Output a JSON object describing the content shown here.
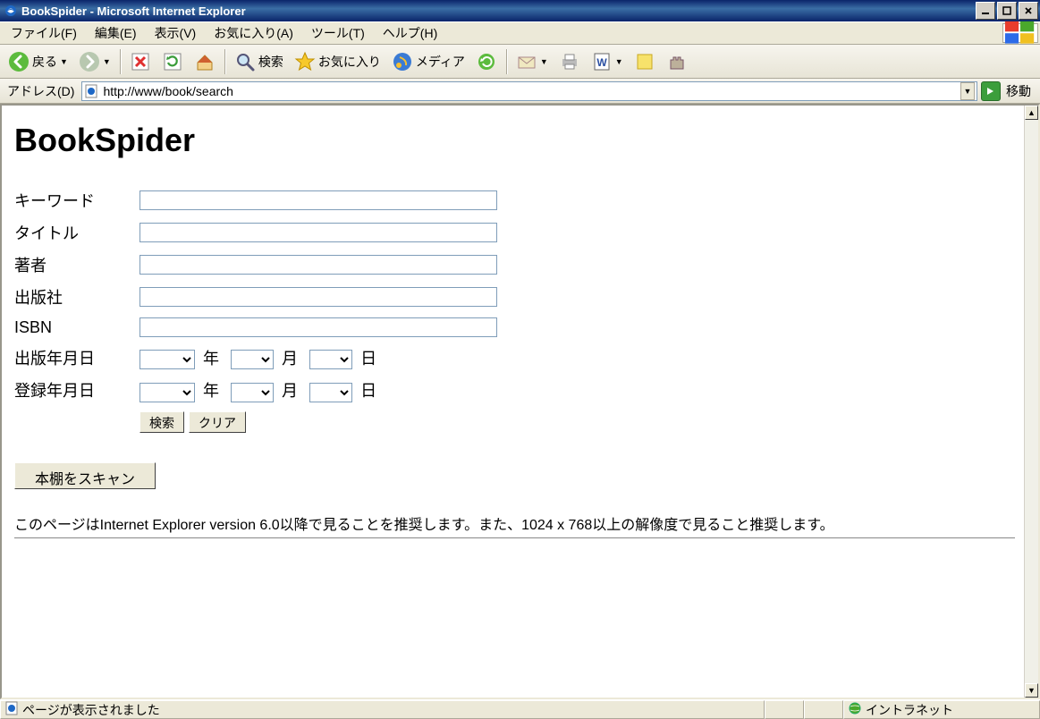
{
  "window": {
    "title": "BookSpider - Microsoft Internet Explorer"
  },
  "menubar": {
    "file": "ファイル(F)",
    "edit": "編集(E)",
    "view": "表示(V)",
    "fav": "お気に入り(A)",
    "tools": "ツール(T)",
    "help": "ヘルプ(H)"
  },
  "toolbar": {
    "back": "戻る",
    "search": "検索",
    "favorites": "お気に入り",
    "media": "メディア"
  },
  "address": {
    "label": "アドレス(D)",
    "url": "http://www/book/search",
    "go": "移動"
  },
  "page": {
    "heading": "BookSpider",
    "fields": {
      "keyword": "キーワード",
      "title": "タイトル",
      "author": "著者",
      "publisher": "出版社",
      "isbn": "ISBN",
      "pubdate": "出版年月日",
      "regdate": "登録年月日"
    },
    "units": {
      "year": "年",
      "month": "月",
      "day": "日"
    },
    "buttons": {
      "search": "検索",
      "clear": "クリア",
      "scan": "本棚をスキャン"
    },
    "footnote": "このページはInternet Explorer version 6.0以降で見ることを推奨します。また、1024 x 768以上の解像度で見ること推奨します。"
  },
  "status": {
    "message": "ページが表示されました",
    "zone": "イントラネット"
  }
}
